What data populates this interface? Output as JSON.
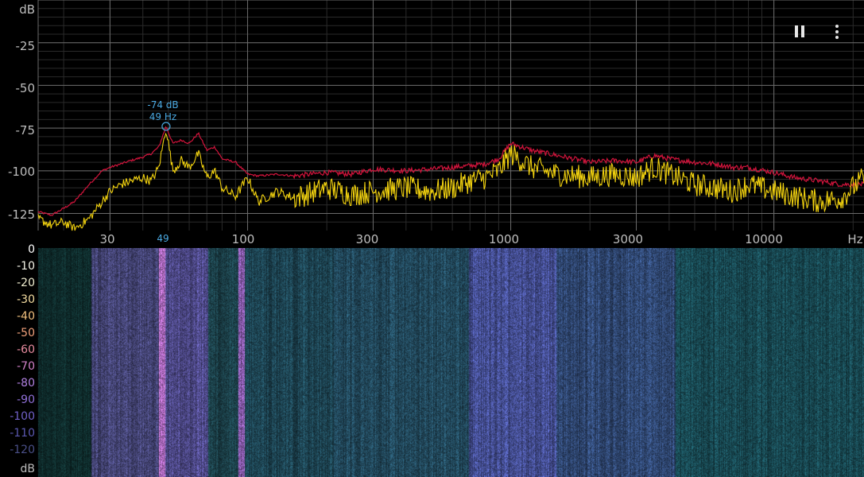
{
  "spectrum": {
    "y_unit": "dB",
    "y_ticks": [
      "-25",
      "-50",
      "-75",
      "-100",
      "-125"
    ],
    "x_unit": "Hz",
    "x_ticks": [
      "30",
      "100",
      "300",
      "1000",
      "3000",
      "10000"
    ],
    "peak": {
      "db_label": "-74 dB",
      "freq_label": "49 Hz",
      "axis_marker": "49"
    },
    "colors": {
      "live": "#f2d20f",
      "hold": "#d2143c",
      "grid": "#3a3a3a",
      "marker": "#4aa8e0"
    }
  },
  "controls": {
    "pause_icon": "pause-icon",
    "more_icon": "more-vert-icon"
  },
  "spectrogram": {
    "legend": [
      "0",
      "-10",
      "-20",
      "-30",
      "-40",
      "-50",
      "-60",
      "-70",
      "-80",
      "-90",
      "-100",
      "-110",
      "-120"
    ],
    "legend_colors": [
      "#ffffff",
      "#f4f4e8",
      "#f0eed0",
      "#f3dca0",
      "#f1c07e",
      "#f0a07a",
      "#e88ca0",
      "#d080c8",
      "#b080e0",
      "#9070d8",
      "#7060c8",
      "#5a58b0",
      "#4a5088"
    ],
    "unit": "dB"
  },
  "chart_data": {
    "type": "line",
    "title": "",
    "xlabel": "Hz",
    "ylabel": "dB",
    "x_scale": "log",
    "xlim": [
      16,
      22000
    ],
    "ylim": [
      -135,
      0
    ],
    "x_ticks": [
      30,
      100,
      300,
      1000,
      3000,
      10000
    ],
    "y_ticks": [
      -25,
      -50,
      -75,
      -100,
      -125
    ],
    "grid": true,
    "peak_marker": {
      "x": 49,
      "y": -74
    },
    "series": [
      {
        "x": [
          16,
          18,
          20,
          22,
          25,
          28,
          30,
          33,
          36,
          40,
          43,
          46,
          49,
          52,
          56,
          60,
          65,
          70,
          75,
          80,
          90,
          100,
          110,
          130,
          150,
          200,
          250,
          300,
          400,
          500,
          600,
          700,
          800,
          900,
          1000,
          1200,
          1500,
          2000,
          2500,
          3000,
          3500,
          4000,
          5000,
          6000,
          7000,
          8000,
          10000,
          12000,
          15000,
          18000,
          22000
        ],
        "y": [
          -124,
          -126,
          -122,
          -118,
          -108,
          -100,
          -98,
          -96,
          -94,
          -92,
          -90,
          -86,
          -74,
          -84,
          -82,
          -84,
          -78,
          -88,
          -86,
          -93,
          -95,
          -102,
          -103,
          -102,
          -103,
          -101,
          -102,
          -99,
          -100,
          -99,
          -98,
          -97,
          -96,
          -93,
          -84,
          -88,
          -91,
          -95,
          -94,
          -95,
          -91,
          -93,
          -95,
          -96,
          -98,
          -98,
          -101,
          -104,
          -106,
          -108,
          -108
        ]
      },
      {
        "x": [
          16,
          18,
          20,
          22,
          25,
          28,
          30,
          33,
          36,
          40,
          43,
          46,
          49,
          52,
          56,
          60,
          65,
          70,
          75,
          80,
          90,
          100,
          110,
          130,
          150,
          200,
          250,
          300,
          400,
          500,
          600,
          700,
          800,
          900,
          1000,
          1200,
          1500,
          2000,
          2500,
          3000,
          3500,
          4000,
          5000,
          6000,
          7000,
          8000,
          10000,
          12000,
          15000,
          18000,
          22000
        ],
        "y": [
          -128,
          -132,
          -130,
          -134,
          -128,
          -118,
          -112,
          -108,
          -106,
          -104,
          -106,
          -98,
          -75,
          -100,
          -94,
          -98,
          -90,
          -104,
          -100,
          -110,
          -115,
          -104,
          -118,
          -112,
          -116,
          -110,
          -114,
          -112,
          -110,
          -112,
          -110,
          -106,
          -104,
          -100,
          -90,
          -98,
          -102,
          -104,
          -102,
          -104,
          -98,
          -102,
          -108,
          -110,
          -112,
          -108,
          -112,
          -115,
          -118,
          -116,
          -104
        ]
      }
    ]
  }
}
